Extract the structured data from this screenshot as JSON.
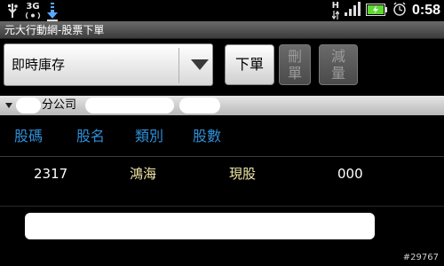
{
  "status_bar": {
    "usb_icon": "usb-icon",
    "network_label": "3G",
    "download_icon": "download-arrow-icon",
    "h_label": "H",
    "signal_icon": "signal-bars-icon",
    "battery_icon": "battery-charging-icon",
    "alarm_icon": "alarm-clock-icon",
    "time": "0:58"
  },
  "title_bar": {
    "title": "元大行動網-股票下單"
  },
  "toolbar": {
    "select_value": "即時庫存",
    "order_label": "下單",
    "delete_label": "刪單",
    "reduce_label": "減量"
  },
  "branch": {
    "label": "分公司"
  },
  "table": {
    "headers": [
      "股碼",
      "股名",
      "類別",
      "股數"
    ],
    "rows": [
      {
        "code": "2317",
        "name": "鴻海",
        "type": "現股",
        "qty": "000"
      }
    ]
  },
  "watermark": "#29767",
  "colors": {
    "header_text": "#2e8fd8",
    "name_text": "#f2e8a8",
    "background": "#000000"
  }
}
